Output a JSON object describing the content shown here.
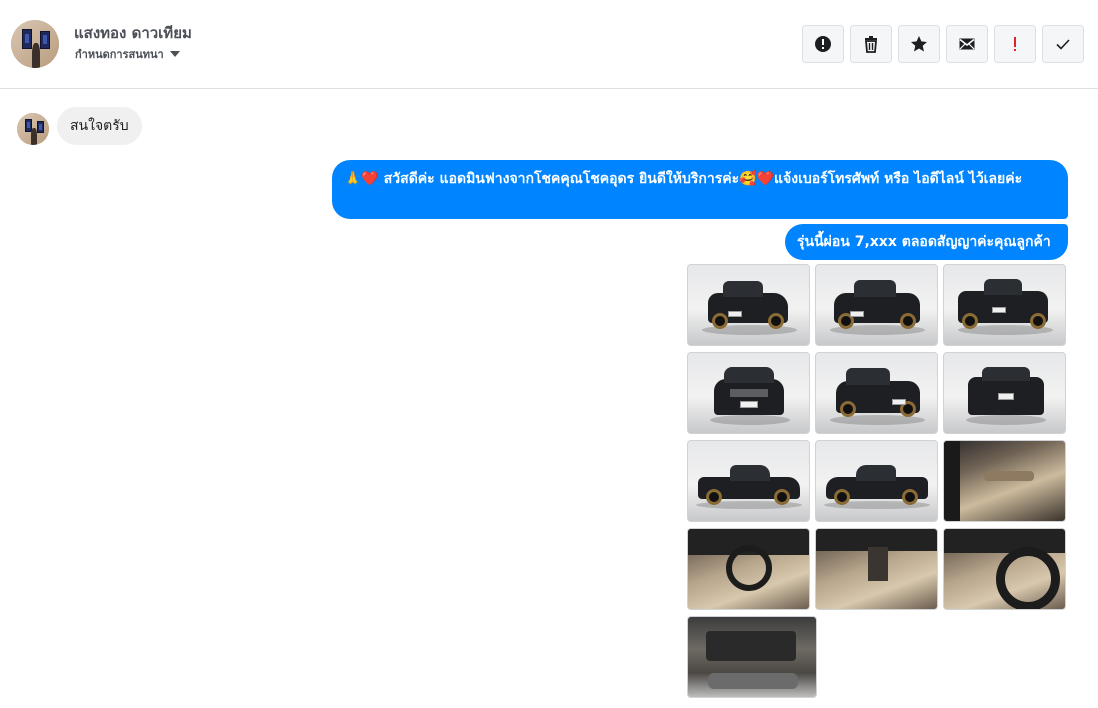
{
  "header": {
    "contact_name": "แสงทอง ดาวเทียม",
    "conversation_settings": "กำหนดการสนทนา",
    "actions": [
      {
        "name": "spam-icon",
        "tooltip": "spam"
      },
      {
        "name": "trash-icon",
        "tooltip": "delete"
      },
      {
        "name": "star-icon",
        "tooltip": "star"
      },
      {
        "name": "mail-icon",
        "tooltip": "unread"
      },
      {
        "name": "exclamation-icon",
        "tooltip": "important"
      },
      {
        "name": "check-icon",
        "tooltip": "done"
      }
    ]
  },
  "messages": {
    "incoming": [
      {
        "text": "สนใจตรับ"
      }
    ],
    "outgoing": [
      {
        "emoji_prefix": "🙏❤️",
        "text_a": " สวัสดีค่ะ แอดมินฟางจากโชคคุณโชคอุดร ยินดีให้บริการค่ะ",
        "emoji_mid": "🥰❤️",
        "text_b": "แจ้งเบอร์โทรศัพท์ หรือ ไอดีไลน์  ไว้เลยค่ะ"
      },
      {
        "text": "รุ่นนี้ผ่อน 7,xxx ตลอดสัญญาค่ะคุณลูกค้า"
      }
    ],
    "photo_count": 13
  },
  "colors": {
    "outgoing_bubble": "#0084ff",
    "incoming_bubble": "#f1f0f0",
    "important_accent": "#e02424"
  }
}
